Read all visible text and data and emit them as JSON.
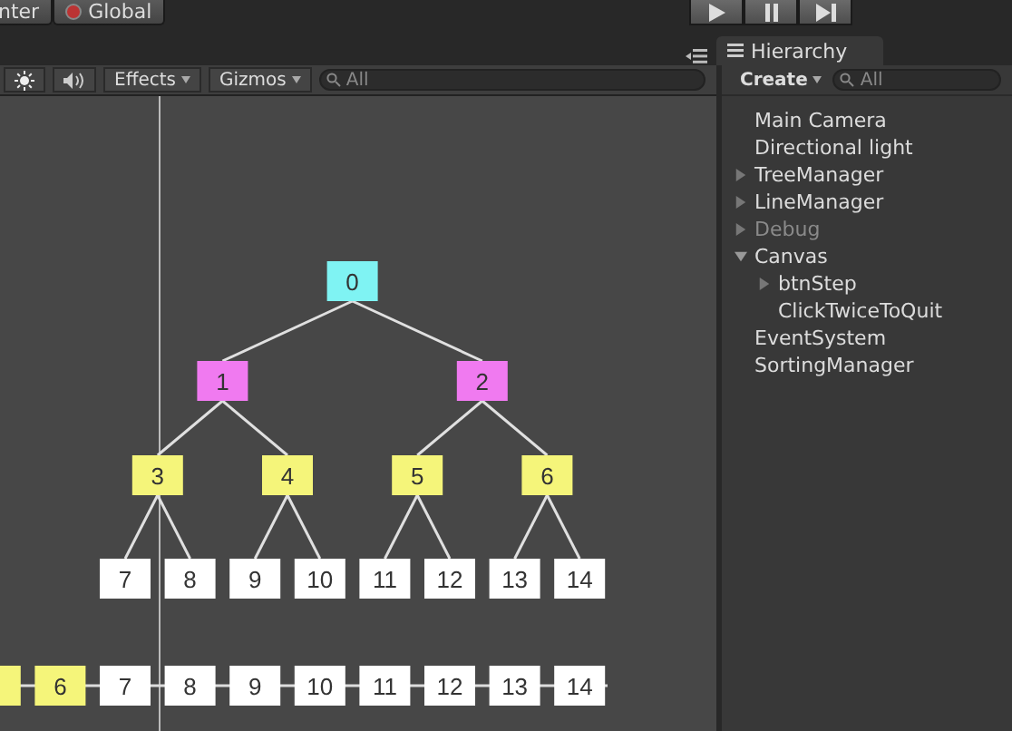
{
  "toolbar": {
    "pivot_button": "nter",
    "space_button": "Global"
  },
  "scene": {
    "toolbar": {
      "effects": "Effects",
      "gizmos": "Gizmos",
      "search": {
        "placeholder": "All"
      }
    },
    "tree": {
      "label": "0",
      "color": "#7ff3f3",
      "children": [
        {
          "label": "1",
          "color": "#f07af0",
          "children": [
            {
              "label": "3",
              "color": "#f5f57a",
              "children": [
                {
                  "label": "7",
                  "color": "#ffffff"
                },
                {
                  "label": "8",
                  "color": "#ffffff"
                }
              ]
            },
            {
              "label": "4",
              "color": "#f5f57a",
              "children": [
                {
                  "label": "9",
                  "color": "#ffffff"
                },
                {
                  "label": "10",
                  "color": "#ffffff"
                }
              ]
            }
          ]
        },
        {
          "label": "2",
          "color": "#f07af0",
          "children": [
            {
              "label": "5",
              "color": "#f5f57a",
              "children": [
                {
                  "label": "11",
                  "color": "#ffffff"
                },
                {
                  "label": "12",
                  "color": "#ffffff"
                }
              ]
            },
            {
              "label": "6",
              "color": "#f5f57a",
              "children": [
                {
                  "label": "13",
                  "color": "#ffffff"
                },
                {
                  "label": "14",
                  "color": "#ffffff"
                }
              ]
            }
          ]
        }
      ]
    },
    "array": [
      {
        "color": "#f5f57a"
      },
      {
        "label": "6",
        "color": "#f5f57a"
      },
      {
        "label": "7",
        "color": "#ffffff"
      },
      {
        "label": "8",
        "color": "#ffffff"
      },
      {
        "label": "9",
        "color": "#ffffff"
      },
      {
        "label": "10",
        "color": "#ffffff"
      },
      {
        "label": "11",
        "color": "#ffffff"
      },
      {
        "label": "12",
        "color": "#ffffff"
      },
      {
        "label": "13",
        "color": "#ffffff"
      },
      {
        "label": "14",
        "color": "#ffffff"
      }
    ]
  },
  "hierarchy": {
    "tab": "Hierarchy",
    "create": "Create",
    "search": {
      "placeholder": "All"
    },
    "items": [
      {
        "name": "Main Camera",
        "disabled": false
      },
      {
        "name": "Directional light",
        "disabled": false
      },
      {
        "name": "TreeManager",
        "disabled": false,
        "expanded": false
      },
      {
        "name": "LineManager",
        "disabled": false,
        "expanded": false
      },
      {
        "name": "Debug",
        "disabled": true,
        "expanded": false
      },
      {
        "name": "Canvas",
        "disabled": false,
        "expanded": true,
        "children": [
          {
            "name": "btnStep",
            "disabled": false,
            "expanded": false
          },
          {
            "name": "ClickTwiceToQuit",
            "disabled": false
          }
        ]
      },
      {
        "name": "EventSystem",
        "disabled": false
      },
      {
        "name": "SortingManager",
        "disabled": false
      }
    ]
  }
}
